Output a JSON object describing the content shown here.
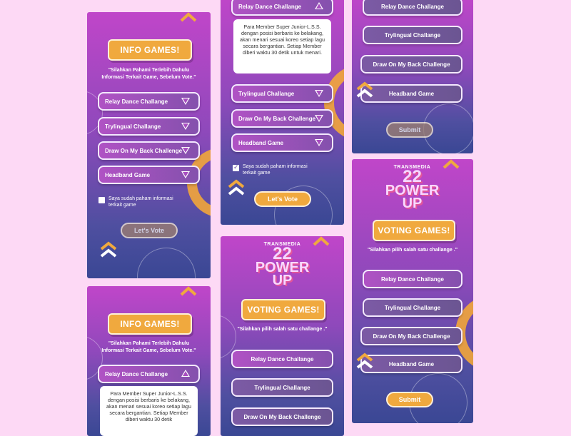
{
  "info": {
    "title": "INFO GAMES!",
    "note": "\"Silahkan Pahami Terlebih Dahulu Informasi Terkait Game, Sebelum Vote.\"",
    "items": [
      "Relay Dance Challange",
      "Trylingual Challange",
      "Draw On My Back Challenge",
      "Headband Game"
    ],
    "expanded_items": [
      "Trylingual Challange",
      "Draw On My Back Challenge",
      "Headband Game"
    ],
    "relay_desc": "Para Member Super Junior-L.S.S. dengan posisi berbaris ke belakang, akan menari sesuai koreo setiap lagu secara bergantian. Setiap Member diberi waktu 30 detik untuk menari.",
    "relay_desc_partial": "Para Member Super Junior-L.S.S. dengan posisi berbaris ke belakang, akan menari sesuai koreo setiap lagu secara bergantian. Setiap Member diberi waktu 30 detik",
    "checkbox_label": "Saya sudah paham informasi terkait game",
    "vote_button": "Let's Vote"
  },
  "voting": {
    "logo_brand": "TRANSMEDIA",
    "logo_number": "22",
    "logo_text": "POWER UP",
    "title": "VOTING GAMES!",
    "note": "\"Silahkan pilih salah satu challange .\"",
    "items": [
      "Relay Dance Challange",
      "Trylingual Challange",
      "Draw On My Back Challenge",
      "Headband Game"
    ],
    "submit_button": "Submit"
  },
  "colors": {
    "accent": "#f0a93e",
    "background": "#fdd9f5",
    "phone_top": "#c046c9",
    "phone_bottom": "#3a4794"
  }
}
